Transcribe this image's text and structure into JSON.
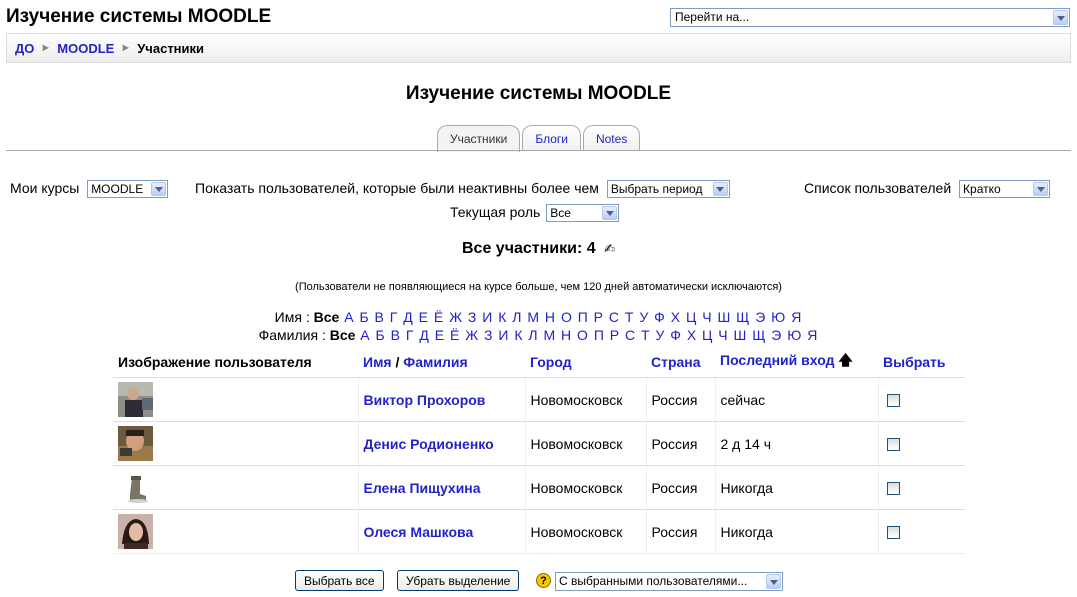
{
  "header": {
    "site_title": "Изучение системы MOODLE",
    "jump_placeholder": "Перейти на..."
  },
  "breadcrumb": {
    "items": [
      "ДО",
      "MOODLE"
    ],
    "current": "Участники",
    "separator": "►"
  },
  "heading": "Изучение системы MOODLE",
  "tabs": [
    {
      "label": "Участники",
      "active": true
    },
    {
      "label": "Блоги",
      "active": false
    },
    {
      "label": "Notes",
      "active": false
    }
  ],
  "filters": {
    "my_courses_label": "Мои курсы",
    "my_courses_value": "MOODLE",
    "inactive_label": "Показать пользователей, которые были неактивны более чем",
    "inactive_value": "Выбрать период",
    "list_label": "Список пользователей",
    "list_value": "Кратко",
    "role_label": "Текущая роль",
    "role_value": "Все"
  },
  "all_participants": "Все участники: 4",
  "note": "(Пользователи не появляющиеся на курсе больше, чем 120 дней автоматически исключаются)",
  "alpha": {
    "first_label": "Имя :",
    "last_label": "Фамилия :",
    "all": "Все",
    "letters": [
      "А",
      "Б",
      "В",
      "Г",
      "Д",
      "Е",
      "Ё",
      "Ж",
      "З",
      "И",
      "К",
      "Л",
      "М",
      "Н",
      "О",
      "П",
      "Р",
      "С",
      "Т",
      "У",
      "Ф",
      "Х",
      "Ц",
      "Ч",
      "Ш",
      "Щ",
      "Э",
      "Ю",
      "Я"
    ]
  },
  "table": {
    "headers": {
      "picture": "Изображение пользователя",
      "first": "Имя",
      "slash": " / ",
      "last": "Фамилия",
      "city": "Город",
      "country": "Страна",
      "lastaccess": "Последний вход",
      "select": "Выбрать"
    },
    "rows": [
      {
        "name": "Виктор Прохоров",
        "city": "Новомосковск",
        "country": "Россия",
        "lastaccess": "сейчас"
      },
      {
        "name": "Денис Родионенко",
        "city": "Новомосковск",
        "country": "Россия",
        "lastaccess": "2 д 14 ч"
      },
      {
        "name": "Елена Пищухина",
        "city": "Новомосковск",
        "country": "Россия",
        "lastaccess": "Никогда"
      },
      {
        "name": "Олеся Машкова",
        "city": "Новомосковск",
        "country": "Россия",
        "lastaccess": "Никогда"
      }
    ]
  },
  "bottom": {
    "select_all": "Выбрать все",
    "deselect": "Убрать выделение",
    "with_selected": "С выбранными пользователями...",
    "help": "?"
  },
  "colors": {
    "link": "#2222cc",
    "help": "#f5c800"
  }
}
